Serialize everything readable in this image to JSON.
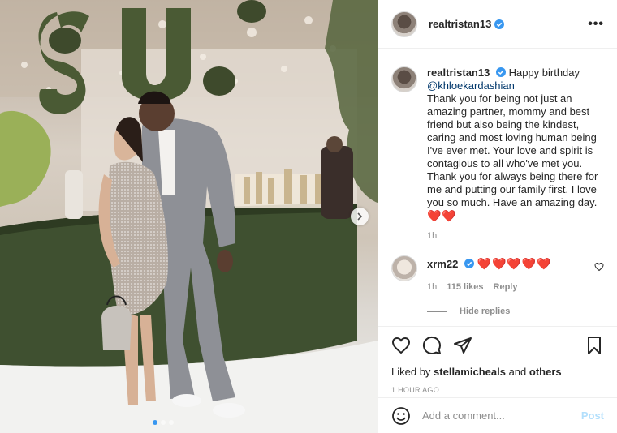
{
  "post": {
    "username": "realtristan13",
    "more_label": "•••",
    "caption": {
      "username": "realtristan13",
      "intro": "Happy birthday",
      "mention": "@khloekardashian",
      "body": "Thank you for being not just an amazing partner, mommy and best friend but also being the kindest, caring and most loving human being I've ever met. Your love and spirit is contagious to all who've met you. Thank you for always being there for me and putting our family first. I love you so much. Have an amazing day.",
      "hearts": "❤️❤️",
      "time": "1h"
    },
    "comment": {
      "username": "xrm22",
      "hearts": "❤️❤️❤️❤️❤️",
      "time": "1h",
      "likes": "115 likes",
      "reply_label": "Reply",
      "hide_replies": "Hide replies"
    },
    "liked_by": {
      "prefix": "Liked by",
      "user": "stellamicheals",
      "and": "and",
      "others": "others"
    },
    "timestamp": "1 HOUR AGO",
    "add_comment": {
      "placeholder": "Add a comment...",
      "post_label": "Post"
    }
  },
  "colors": {
    "verified": "#3897f0",
    "heart": "#ed4956",
    "post_button": "#b2dffc"
  },
  "icons": [
    "verified-icon",
    "more-icon",
    "heart-icon",
    "comment-icon",
    "share-icon",
    "save-icon",
    "emoji-icon",
    "next-arrow-icon"
  ]
}
